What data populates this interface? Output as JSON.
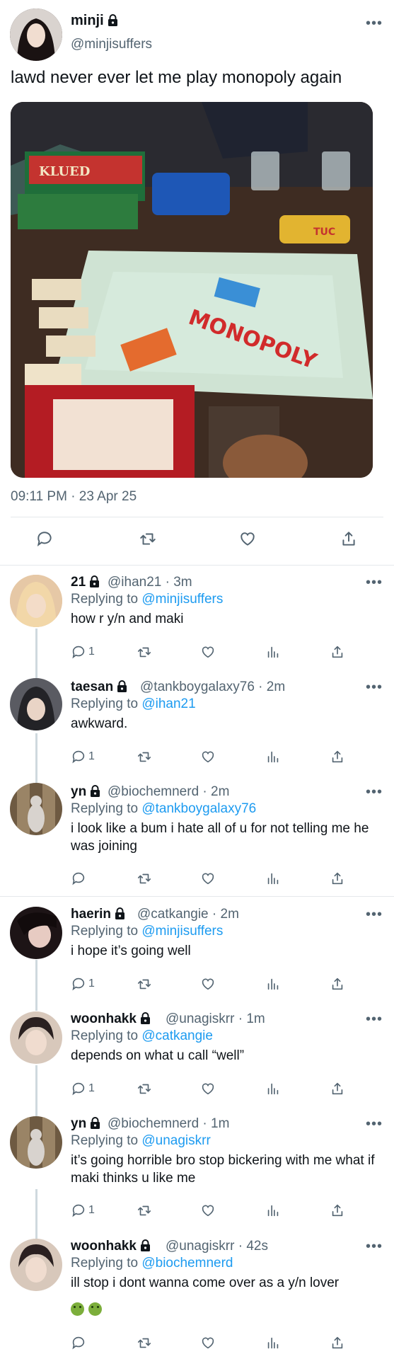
{
  "main_tweet": {
    "name": "minji",
    "handle": "@minjisuffers",
    "text": "lawd never ever let me play monopoly again",
    "photo_board_text": "MONOPOLY",
    "photo_box_text": "KLUED",
    "photo_snack_text": "TUC",
    "timestamp": "09:11 PM · 23 Apr 25"
  },
  "replies": [
    {
      "name": "21",
      "meta": "@ihan21 · 3m",
      "replying_prefix": "Replying to ",
      "replying_to": "@minjisuffers",
      "text": "how r y/n and maki",
      "reply_count": "1",
      "avatar_color": "#e9c9a8"
    },
    {
      "name": "taesan",
      "meta": "@tankboygalaxy76 · 2m",
      "replying_prefix": "Replying to ",
      "replying_to": "@ihan21",
      "text": "awkward.",
      "reply_count": "1",
      "avatar_color": "#4a4a52"
    },
    {
      "name": "yn",
      "meta": "@biochemnerd · 2m",
      "replying_prefix": "Replying to ",
      "replying_to": "@tankboygalaxy76",
      "text": "i look like a bum i hate all of u for not telling me he was joining",
      "reply_count": "",
      "avatar_color": "#8a7255"
    },
    {
      "name": "haerin",
      "meta": "@catkangie · 2m",
      "replying_prefix": "Replying to ",
      "replying_to": "@minjisuffers",
      "text": "i hope it’s going well",
      "reply_count": "1",
      "avatar_color": "#2b1f22"
    },
    {
      "name": "woonhakk",
      "meta": "@unagiskrr · 1m",
      "replying_prefix": "Replying to ",
      "replying_to": "@catkangie",
      "text": "depends on what u call “well”",
      "reply_count": "1",
      "avatar_color": "#d9c2b0"
    },
    {
      "name": "yn",
      "meta": "@biochemnerd · 1m",
      "replying_prefix": "Replying to ",
      "replying_to": "@unagiskrr",
      "text": "it’s going horrible bro stop bickering with me what if maki thinks u like me",
      "reply_count": "1",
      "avatar_color": "#8a7255"
    },
    {
      "name": "woonhakk",
      "meta": "@unagiskrr · 42s",
      "replying_prefix": "Replying to ",
      "replying_to": "@biochemnerd",
      "text": "ill stop i dont wanna come over as a y/n lover",
      "reply_count": "",
      "avatar_color": "#d9c2b0"
    }
  ],
  "icons": {
    "more": "more-icon",
    "lock": "lock-icon",
    "reply": "reply-icon",
    "retweet": "retweet-icon",
    "like": "heart-icon",
    "views": "views-icon",
    "share": "share-icon"
  },
  "colors": {
    "link": "#1d9bf0",
    "muted": "#536471",
    "text": "#0f1419"
  }
}
